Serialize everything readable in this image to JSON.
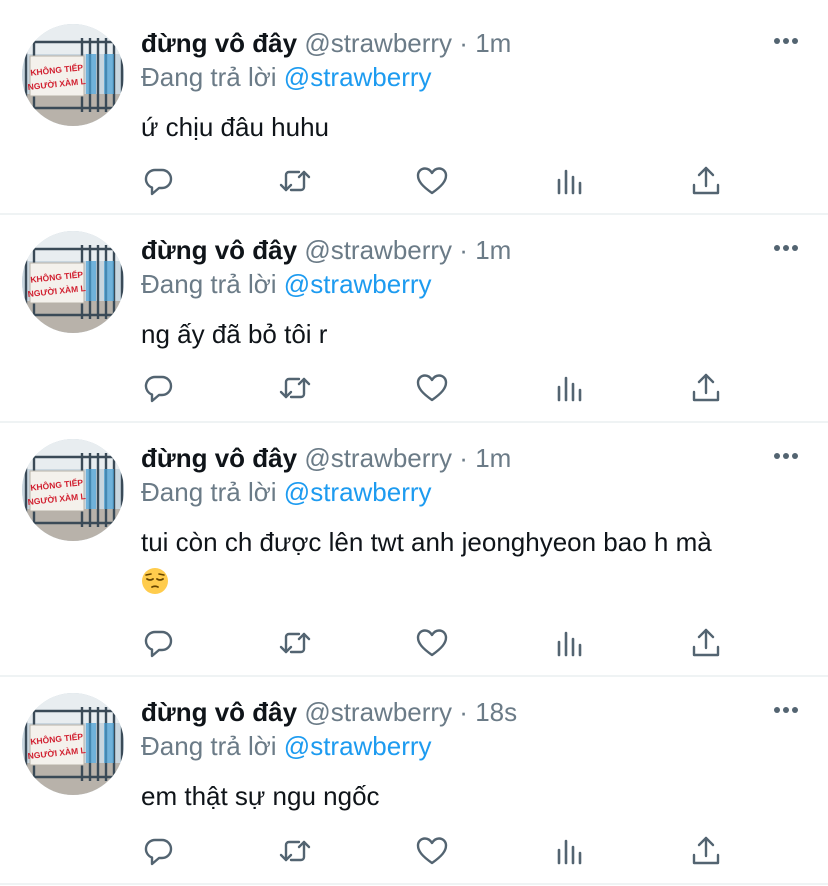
{
  "tweets": [
    {
      "name": "đừng vô đây",
      "handle": "@strawberry",
      "separator": "·",
      "time": "1m",
      "replying_prefix": "Đang trả lời",
      "replying_to": "@strawberry",
      "text": "ứ chịu đâu huhu",
      "emoji": ""
    },
    {
      "name": "đừng vô đây",
      "handle": "@strawberry",
      "separator": "·",
      "time": "1m",
      "replying_prefix": "Đang trả lời",
      "replying_to": "@strawberry",
      "text": "ng ấy đã bỏ tôi r",
      "emoji": ""
    },
    {
      "name": "đừng vô đây",
      "handle": "@strawberry",
      "separator": "·",
      "time": "1m",
      "replying_prefix": "Đang trả lời",
      "replying_to": "@strawberry",
      "text": "tui còn ch được lên twt anh jeonghyeon bao h mà",
      "emoji": "pensive-face"
    },
    {
      "name": "đừng vô đây",
      "handle": "@strawberry",
      "separator": "·",
      "time": "18s",
      "replying_prefix": "Đang trả lời",
      "replying_to": "@strawberry",
      "text": "em thật sự ngu ngốc",
      "emoji": ""
    }
  ],
  "avatar_sign_text": [
    "KHÔNG TIẾP",
    "NGƯỜI XÀM L"
  ],
  "icons": {
    "reply": "reply-icon",
    "retweet": "retweet-icon",
    "like": "like-icon",
    "analytics": "analytics-icon",
    "share": "share-icon",
    "more": "more-icon"
  },
  "colors": {
    "text": "#0f1419",
    "secondary": "#6b7b87",
    "accent": "#1d9bf0",
    "divider": "#eff3f4",
    "icon": "#536471"
  }
}
